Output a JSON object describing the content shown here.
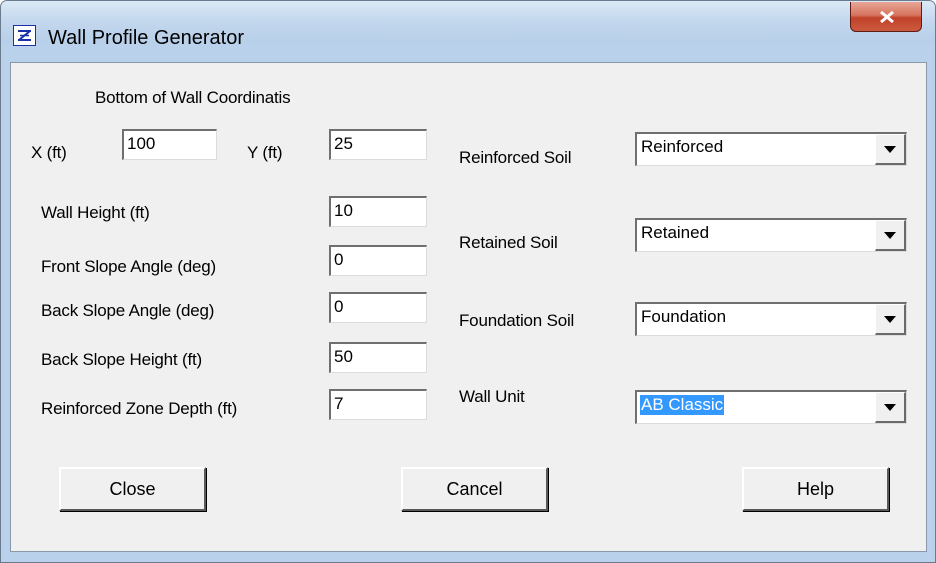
{
  "window": {
    "title": "Wall Profile Generator",
    "icon": "z-dialog-icon",
    "close_icon": "close-x-icon"
  },
  "left": {
    "section_title": "Bottom of Wall Coordinatis",
    "x_label": "X (ft)",
    "x_value": "100",
    "y_label": "Y (ft)",
    "y_value": "25",
    "wall_height_label": "Wall Height (ft)",
    "wall_height_value": "10",
    "front_slope_label": "Front Slope Angle (deg)",
    "front_slope_value": "0",
    "back_slope_angle_label": "Back Slope Angle (deg)",
    "back_slope_angle_value": "0",
    "back_slope_height_label": "Back Slope Height (ft)",
    "back_slope_height_value": "50",
    "reinforced_depth_label": "Reinforced Zone Depth (ft)",
    "reinforced_depth_value": "7"
  },
  "right": {
    "reinforced_soil_label": "Reinforced Soil",
    "reinforced_soil_value": "Reinforced",
    "retained_soil_label": "Retained Soil",
    "retained_soil_value": "Retained",
    "foundation_soil_label": "Foundation Soil",
    "foundation_soil_value": "Foundation",
    "wall_unit_label": "Wall Unit",
    "wall_unit_value": "AB Classic"
  },
  "buttons": {
    "close": "Close",
    "cancel": "Cancel",
    "help": "Help"
  },
  "colors": {
    "titlebar": "#c4d8ee",
    "client": "#f0f0f0",
    "close_button": "#c1412a",
    "selection": "#3399ff"
  }
}
